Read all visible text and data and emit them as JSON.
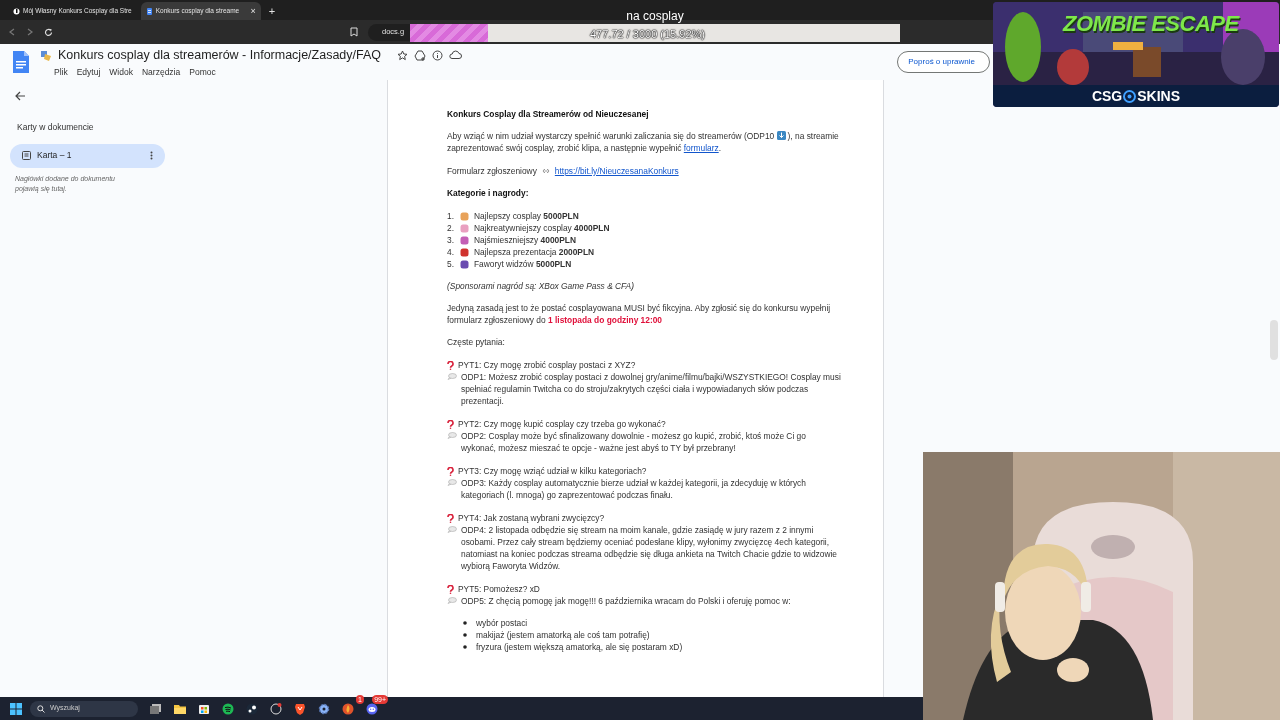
{
  "browser": {
    "tabs": [
      {
        "title": "Mój Własny Konkurs Cosplay dla Stre",
        "selected": false
      },
      {
        "title": "Konkurs cosplay dla streame",
        "selected": true,
        "close": "×"
      }
    ],
    "new_tab": "+",
    "address": "docs.g"
  },
  "docs_header": {
    "title": "Konkurs cosplay dla streamerów - Informacje/Zasady/FAQ",
    "menu": [
      "Plik",
      "Edytuj",
      "Widok",
      "Narzędzia",
      "Pomoc"
    ],
    "request_button": "Poproś o uprawnie"
  },
  "sidebar": {
    "heading": "Karty w dokumencie",
    "tabs": [
      {
        "label": "Karta – 1",
        "selected": true
      }
    ],
    "note": "Nagłówki dodane do dokumentu pojawią się tutaj."
  },
  "document": {
    "title": "Konkurs Cosplay dla Streamerów od Nieuczesanej",
    "intro": [
      {
        "kind": "text",
        "text": "Aby wziąć w nim udział wystarczy spełnić warunki zaliczania się do streamerów (ODP10 "
      },
      {
        "kind": "arrow"
      },
      {
        "kind": "text",
        "text": "), na streamie zaprezentować swój cosplay, zrobić klipa, a następnie wypełnić "
      },
      {
        "kind": "link",
        "text": "formularz"
      },
      {
        "kind": "text",
        "text": "."
      }
    ],
    "form_label": "Formularz zgłoszeniowy",
    "form_link": "https://bit.ly/NieuczesanaKonkurs",
    "categories_heading": "Kategorie i nagrody:",
    "prizes": [
      {
        "number": "1.",
        "text": "Najlepszy cosplay **5000PLN**",
        "color": "#e8a25a"
      },
      {
        "number": "2.",
        "text": "Najkreatywniejszy cosplay **4000PLN**",
        "color": "#e9a0c0"
      },
      {
        "number": "3.",
        "text": "Najśmieszniejszy **4000PLN**",
        "color": "#c45fb5"
      },
      {
        "number": "4.",
        "text": "Najlepsza prezentacja **2000PLN**",
        "color": "#d0322e"
      },
      {
        "number": "5.",
        "text": "Faworyt widzów **5000PLN**",
        "color": "#6a4bb0"
      }
    ],
    "sponsors": "(Sponsorami nagród są: XBox Game Pass & CFA)",
    "rule": [
      {
        "kind": "text",
        "text": "Jedyną zasadą jest to że postać cosplayowana MUSI być fikcyjna. Aby zgłosić się do konkursu wypełnij formularz zgłoszeniowy do "
      },
      {
        "kind": "alert",
        "text": "1 listopada do godziny 12:00"
      }
    ],
    "faq_heading": "Częste pytania:",
    "faq": [
      {
        "question": "PYT1: Czy mogę zrobić cosplay postaci z XYZ?",
        "answer": "ODP1: Możesz zrobić cosplay postaci z dowolnej gry/anime/filmu/bajki/WSZYSTKIEGO! Cosplay musi spełniać regulamin Twitcha co do stroju/zakrytych części ciała i wypowiadanych słów podczas prezentacji."
      },
      {
        "question": "PYT2: Czy mogę kupić cosplay czy trzeba go wykonać?",
        "answer": "ODP2: Cosplay może być sfinalizowany dowolnie - możesz go kupić, zrobić, ktoś może Ci go wykonać, możesz mieszać te opcje - ważne jest abyś to TY był przebrany!"
      },
      {
        "question": "PYT3: Czy mogę wziąć udział w kilku kategoriach?",
        "answer": "ODP3: Każdy cosplay automatycznie bierze udział w każdej kategorii, ja zdecyduję w których kategoriach (l. mnoga) go zaprezentować podczas finału."
      },
      {
        "question": "PYT4: Jak zostaną wybrani zwycięzcy?",
        "answer": "ODP4: 2 listopada odbędzie się stream na moim kanale, gdzie zasiądę w jury razem z 2 innymi osobami. Przez cały stream będziemy oceniać podesłane klipy, wyłonimy zwycięzcę 4ech kategorii, natomiast na koniec podczas streama odbędzie się długa ankieta na Twitch Chacie gdzie to widzowie wybiorą Faworyta Widzów."
      },
      {
        "question": "PYT5: Pomożesz? xD",
        "answer": "ODP5: Z chęcią pomogę jak mogę!!! 6 października wracam do Polski i oferuję pomoc w:",
        "bullets": [
          "wybór postaci",
          "makijaż (jestem amatorką ale coś tam potrafię)",
          "fryzura (jestem większą amatorką, ale się postaram xD)"
        ]
      }
    ]
  },
  "goal": {
    "title": "na cosplay",
    "level": 0.1592,
    "reading": "477.72 / 3000 (15.92%)"
  },
  "banner": {
    "headline": "ZOMBIE ESCAPE",
    "brand_left": "CSG",
    "brand_right": "SKINS"
  },
  "taskbar": {
    "search": "Wyszukaj",
    "badges": [
      "1",
      "99+"
    ]
  }
}
